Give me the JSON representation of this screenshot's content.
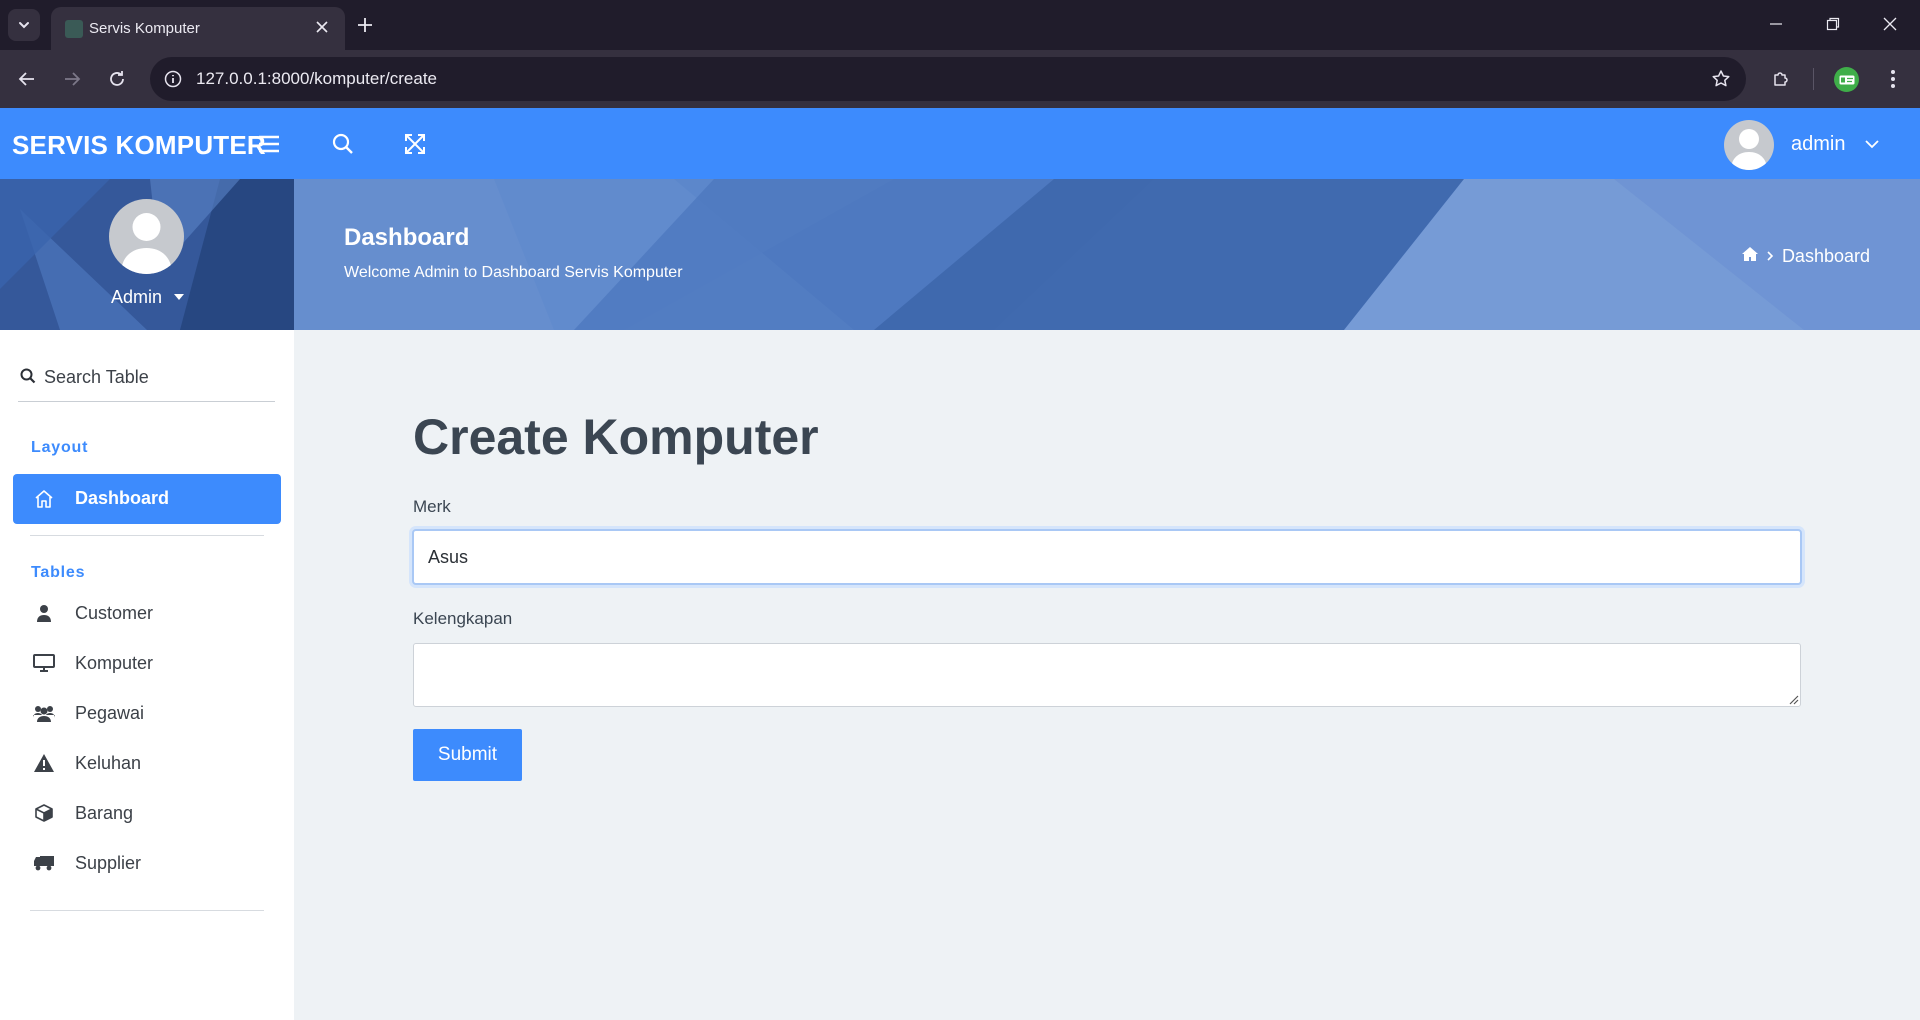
{
  "browser": {
    "tab_title": "Servis Komputer",
    "url": "127.0.0.1:8000/komputer/create"
  },
  "header": {
    "brand": "SERVIS KOMPUTER",
    "user_name": "admin"
  },
  "sidebar": {
    "profile_name": "Admin",
    "search_placeholder": "Search Table",
    "sections": {
      "layout": "Layout",
      "tables": "Tables"
    },
    "active_item": "Dashboard",
    "items": [
      {
        "label": "Customer",
        "icon": "user-icon"
      },
      {
        "label": "Komputer",
        "icon": "desktop-icon"
      },
      {
        "label": "Pegawai",
        "icon": "users-icon"
      },
      {
        "label": "Keluhan",
        "icon": "warning-icon"
      },
      {
        "label": "Barang",
        "icon": "box-icon"
      },
      {
        "label": "Supplier",
        "icon": "truck-icon"
      }
    ]
  },
  "banner": {
    "title": "Dashboard",
    "subtitle": "Welcome Admin to Dashboard Servis Komputer",
    "breadcrumb": "Dashboard"
  },
  "form": {
    "heading": "Create Komputer",
    "merk_label": "Merk",
    "merk_value": "Asus",
    "kelengkapan_label": "Kelengkapan",
    "kelengkapan_value": "",
    "submit_label": "Submit"
  },
  "colors": {
    "primary": "#3d8bfd",
    "banner": "#4e7cc4",
    "page_bg": "#eef2f5",
    "heading_text": "#3b4652"
  }
}
